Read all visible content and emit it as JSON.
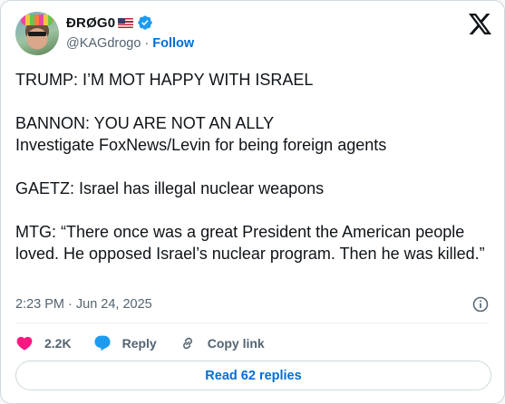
{
  "author": {
    "display_name": "ÐRØG0",
    "handle": "@KAGdrogo",
    "separator": "·",
    "follow_label": "Follow"
  },
  "tweet": {
    "text": "TRUMP: I’M MOT HAPPY WITH ISRAEL\n\nBANNON: YOU ARE NOT AN ALLY\nInvestigate FoxNews/Levin for being foreign agents\n\nGAETZ: Israel has illegal nuclear weapons\n\nMTG: “There once was a great President the American people loved. He opposed Israel’s nuclear program. Then he was killed.”",
    "timestamp": "2:23 PM · Jun 24, 2025"
  },
  "actions": {
    "like_count": "2.2K",
    "reply_label": "Reply",
    "copy_link_label": "Copy link"
  },
  "replies_button": {
    "label": "Read 62 replies"
  },
  "colors": {
    "accent": "#006fd6",
    "like": "#f91880",
    "verified": "#1d9bf0",
    "muted": "#536471"
  },
  "icons": [
    "x-logo-icon",
    "verified-badge-icon",
    "us-flag-icon",
    "info-icon",
    "heart-icon",
    "reply-bubble-icon",
    "link-icon"
  ]
}
